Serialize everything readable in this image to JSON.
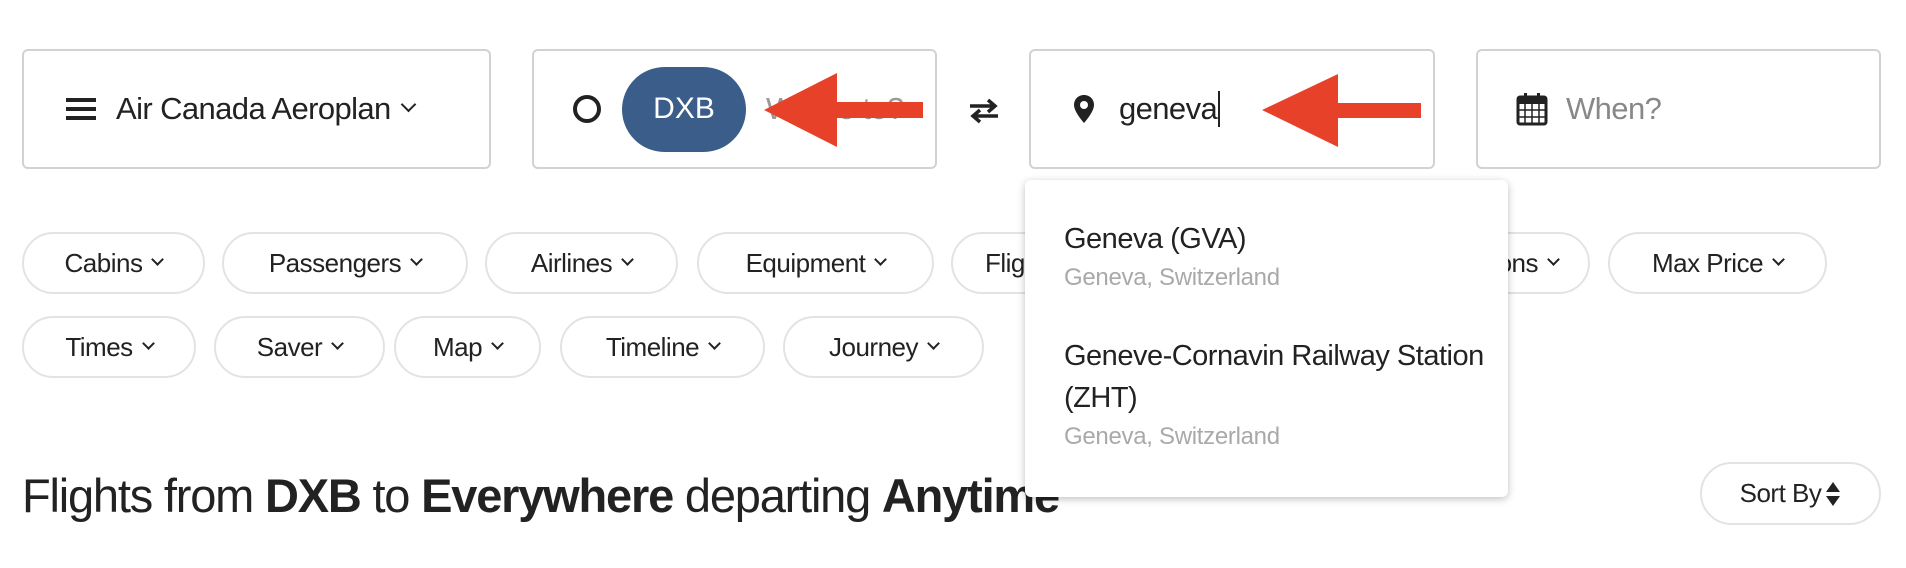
{
  "program_selector": {
    "label": "Air Canada Aeroplan",
    "icon": "menu-icon"
  },
  "origin": {
    "chip": "DXB",
    "placeholder": "Where to?",
    "icon": "circle-icon",
    "chip_color": "#3a5d8a"
  },
  "swap": {
    "icon": "swap-arrows-icon"
  },
  "destination": {
    "value": "geneva",
    "icon": "map-pin-icon"
  },
  "date": {
    "placeholder": "When?",
    "icon": "calendar-icon"
  },
  "filters_row1": [
    "Cabins",
    "Passengers",
    "Airlines",
    "Equipment",
    "Flights",
    "Connections",
    "Max Price"
  ],
  "filters_row2": [
    "Times",
    "Saver",
    "Map",
    "Timeline",
    "Journey"
  ],
  "suggestions": [
    {
      "name": "Geneva (GVA)",
      "location": "Geneva, Switzerland"
    },
    {
      "name": "Geneve-Cornavin Railway Station (ZHT)",
      "location": "Geneva, Switzerland"
    }
  ],
  "heading": {
    "p1": "Flights from ",
    "origin": "DXB",
    "p2": " to ",
    "dest": "Everywhere",
    "p3": " departing ",
    "when": "Anytime"
  },
  "sort": {
    "label": "Sort By"
  },
  "annotation_color": "#e8412a"
}
